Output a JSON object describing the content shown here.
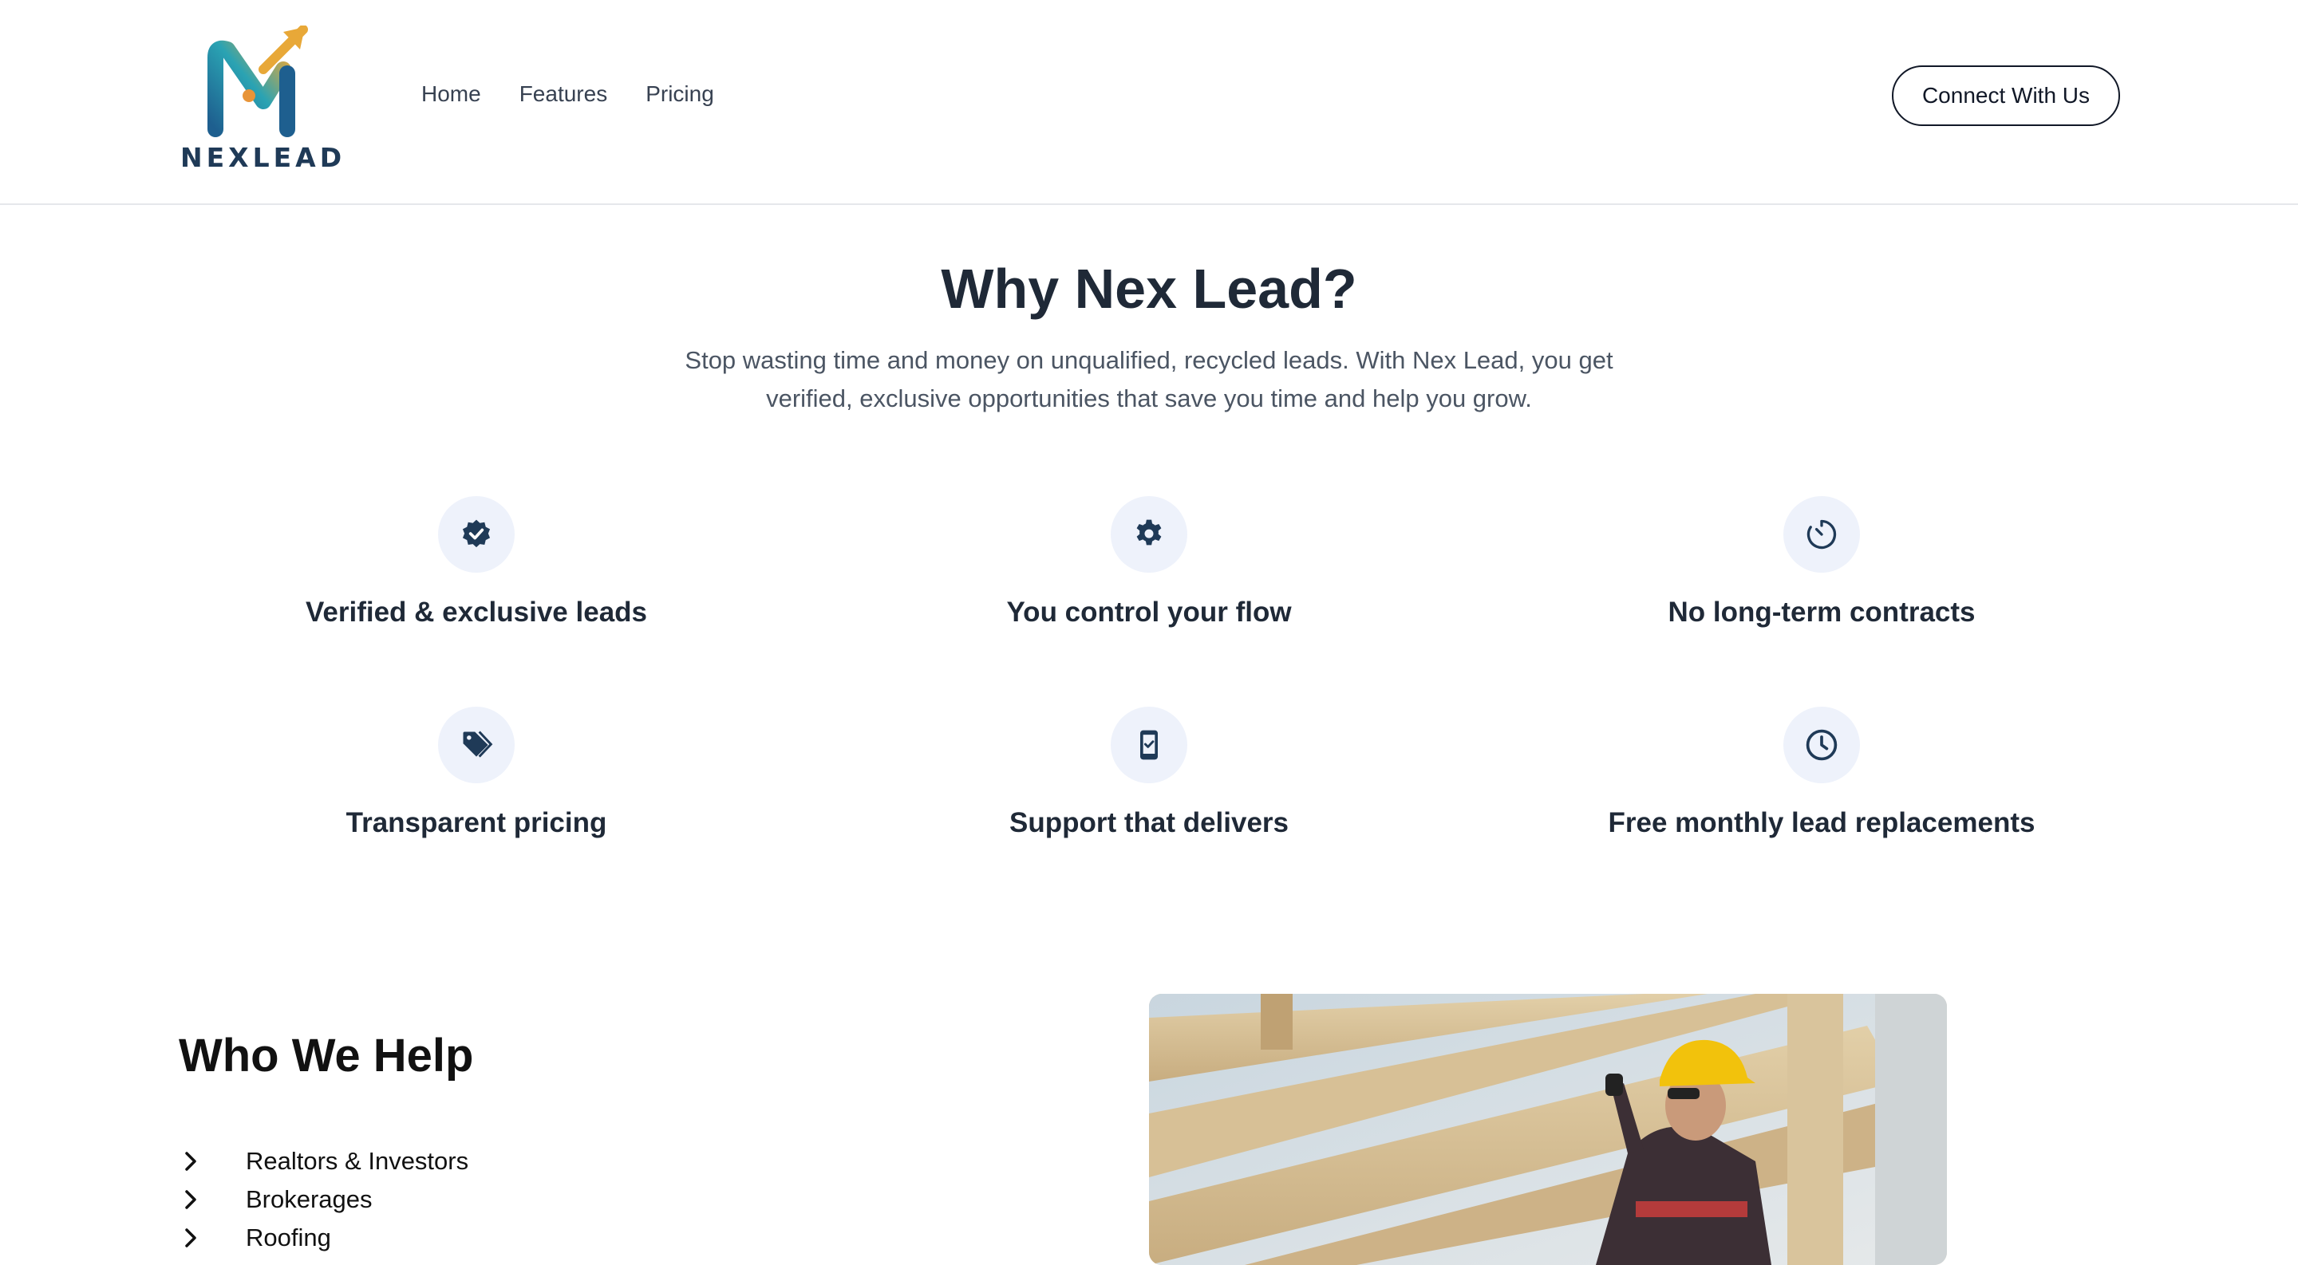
{
  "brand": {
    "name": "NEXLEAD"
  },
  "nav": {
    "items": [
      "Home",
      "Features",
      "Pricing"
    ]
  },
  "header": {
    "cta_label": "Connect With Us"
  },
  "why": {
    "title": "Why Nex Lead?",
    "subtitle": "Stop wasting time and money on unqualified, recycled leads. With Nex Lead, you get verified, exclusive opportunities that save you time and help you grow.",
    "features": [
      {
        "label": "Verified & exclusive leads",
        "icon": "verified-badge-icon"
      },
      {
        "label": "You control your flow",
        "icon": "gear-icon"
      },
      {
        "label": "No long-term contracts",
        "icon": "timer-icon"
      },
      {
        "label": "Transparent pricing",
        "icon": "price-tag-icon"
      },
      {
        "label": "Support that delivers",
        "icon": "phone-check-icon"
      },
      {
        "label": "Free monthly lead replacements",
        "icon": "clock-icon"
      }
    ]
  },
  "who": {
    "title": "Who We Help",
    "items": [
      "Realtors & Investors",
      "Brokerages",
      "Roofing"
    ]
  },
  "colors": {
    "accent_navy": "#1f3a57",
    "icon_bg": "#eef2fb",
    "logo_gold": "#e8a838",
    "logo_teal": "#2a8fa8"
  }
}
